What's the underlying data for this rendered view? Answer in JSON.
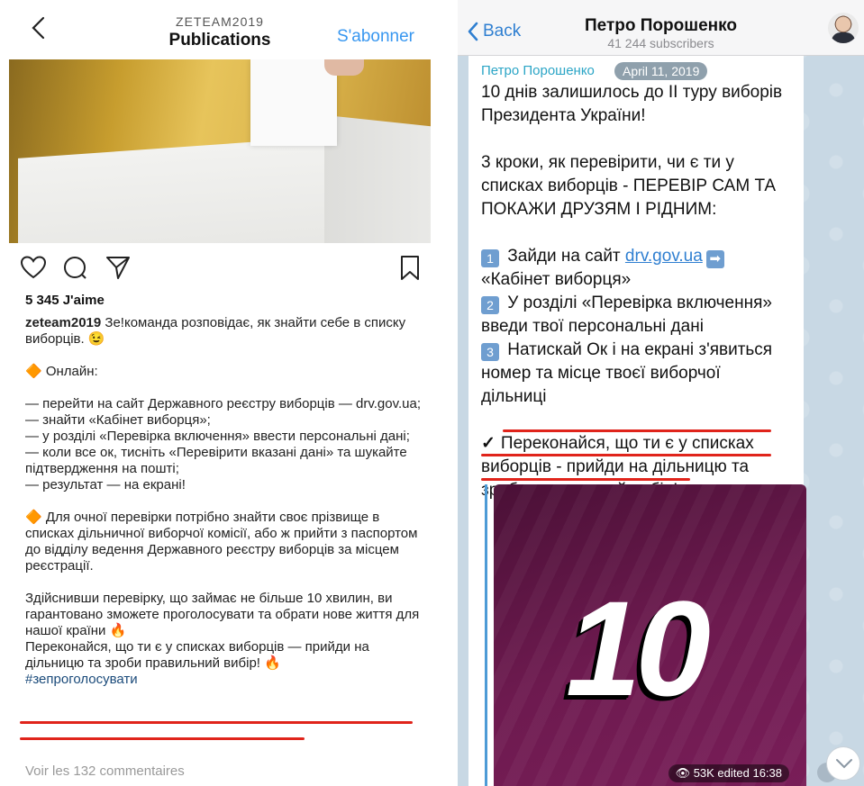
{
  "instagram": {
    "header": {
      "account": "ZETEAM2019",
      "title": "Publications",
      "follow_label": "S'abonner"
    },
    "likes": "5 345 J'aime",
    "caption": {
      "username": "zeteam2019",
      "intro": " Зе!команда розповідає, як знайти себе в списку виборців. 😉",
      "online_heading": "🔶 Онлайн:",
      "steps": [
        "— перейти на сайт Державного реєстру виборців — drv.gov.ua;",
        "— знайти «Кабінет виборця»;",
        "— у розділі «Перевірка включення» ввести персональні дані;",
        "— коли все ок, тисніть «Перевірити вказані дані» та шукайте підтвердження на пошті;",
        "— результат — на екрані!"
      ],
      "offline": "🔶 Для очної перевірки потрібно знайти своє прізвище в списках дільничної виборчої комісії, або ж прийти з паспортом до відділу ведення Державного реєстру виборців за місцем реєстрації.",
      "closing": "Здійснивши перевірку, що займає не більше 10 хвилин, ви гарантовано зможете проголосувати та обрати нове життя для нашої країни 🔥",
      "highlight": "Переконайся, що ти є у списках виборців — прийди на дільницю та зроби правильний вибір! 🔥",
      "hashtag": "#зепроголосувати"
    },
    "comments_link": "Voir les 132 commentaires",
    "accent_color": "#3897f0"
  },
  "telegram": {
    "header": {
      "back_label": "Back",
      "channel_name": "Петро Порошенко",
      "subscribers": "41 244 subscribers"
    },
    "message": {
      "sender": "Петро Порошенко",
      "date": "April 11, 2019",
      "intro": [
        "10 днів залишилось до ІІ туру виборів",
        "Президента України!"
      ],
      "steps_intro": [
        "3 кроки, як перевірити, чи є ти у",
        "списках виборців - ПЕРЕВІР САМ ТА",
        "ПОКАЖИ ДРУЗЯМ І РІДНИМ:"
      ],
      "step1_num": "1",
      "step1_text": " Зайди на сайт ",
      "step1_link": "drv.gov.ua",
      "step1_arrow": "➡",
      "step1_cont": "«Кабінет виборця»",
      "step2_num": "2",
      "step2_lines": [
        " У розділі «Перевірка включення»",
        "введи твої персональні дані"
      ],
      "step3_num": "3",
      "step3_lines": [
        " Натискай Ок і на екрані з'явиться",
        "номер та місце твоєї виборчої",
        "дільниці"
      ],
      "check_mark": "✓",
      "highlight_lines": [
        "Переконайся, що ти є у списках",
        "виборців - прийди на дільницю та",
        "зроби правильний вибір!"
      ],
      "media_number": "10",
      "views_meta": "👁 53K edited 16:38"
    },
    "accent_color": "#2f7fd1"
  }
}
